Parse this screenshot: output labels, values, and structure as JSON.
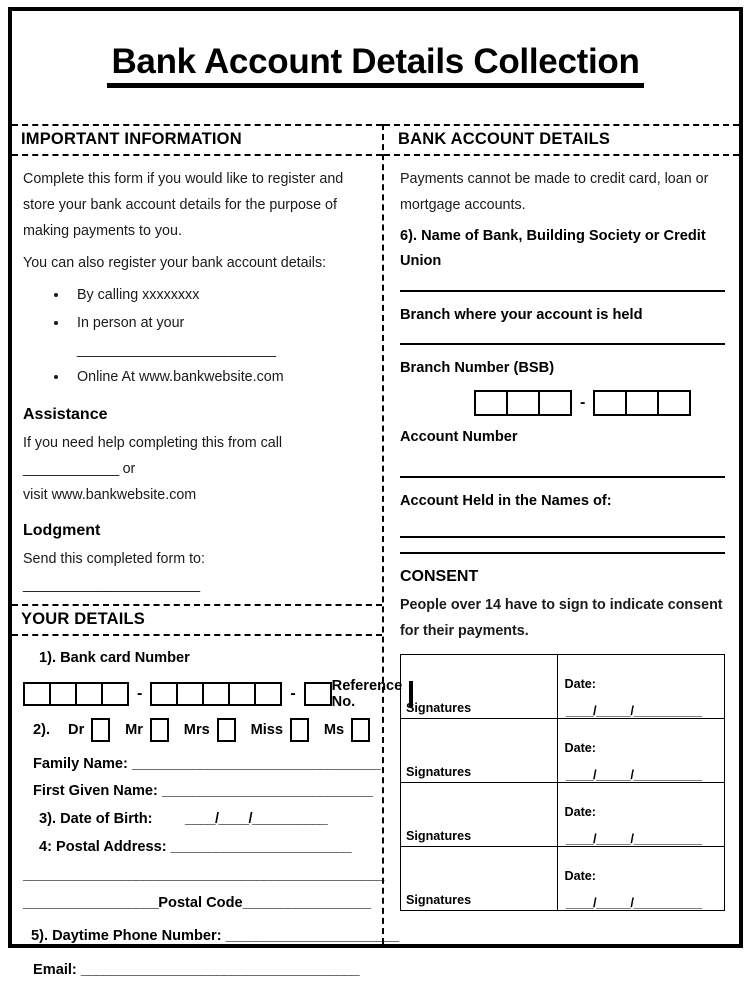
{
  "title": "Bank Account Details Collection",
  "left": {
    "important": {
      "header": "IMPORTANT INFORMATION",
      "intro": "Complete this form if you would like to register and store your bank account details for the purpose of making payments to you.",
      "register_lead": "You can also register your bank account details:",
      "bullets": [
        "By calling xxxxxxxx",
        "In person at your",
        "Online At www.bankwebsite.com"
      ],
      "in_person_blank": "___________________________",
      "assistance_header": "Assistance",
      "assistance_text_before": "If you need help completing this from call",
      "assistance_blank": "_____________",
      "assistance_text_after": "or",
      "assistance_line2": "visit www.bankwebsite.com",
      "lodgment_header": "Lodgment",
      "lodgment_text": "Send this completed form to:",
      "lodgment_blank": "________________________"
    },
    "your_details": {
      "header": "YOUR DETAILS",
      "card_label": "1). Bank card Number",
      "card_group1_boxes": 4,
      "card_group2_boxes": 5,
      "card_group3_boxes": 1,
      "separator": "-",
      "reference_label": "Reference No.",
      "title_row_num": "2).",
      "titles": [
        "Dr",
        "Mr",
        "Mrs",
        "Miss",
        "Ms"
      ],
      "family_name_label": "Family Name:",
      "family_name_blank": "_________________________________",
      "first_name_label": "First Given Name:",
      "first_name_blank": "____________________________",
      "dob_label": "3). Date of Birth:",
      "dob_blank": "____/____/__________",
      "postal_label": "4: Postal Address:",
      "postal_blank1": "________________________",
      "postal_blank2": "________________________________________________",
      "postal_code_pre": "__________________",
      "postal_code_label": "Postal Code",
      "postal_code_post": "_________________",
      "phone_label": "5). Daytime Phone Number:",
      "phone_blank": "_______________________",
      "email_label": "Email:",
      "email_blank": "_____________________________________"
    }
  },
  "right": {
    "bank_details": {
      "header": "BANK ACCOUNT DETAILS",
      "notice": "Payments cannot be made to credit card, loan or mortgage accounts.",
      "bank_name_label": "6). Name of Bank, Building Society or Credit Union",
      "branch_label": "Branch where your account is held",
      "bsb_label": "Branch Number (BSB)",
      "bsb_group1_boxes": 3,
      "bsb_group2_boxes": 3,
      "bsb_separator": "-",
      "account_number_label": "Account Number",
      "account_names_label": "Account Held in the Names of:"
    },
    "consent": {
      "header": "CONSENT",
      "text": "People over 14 have to sign to indicate consent for their payments.",
      "rows": [
        {
          "signature_label": "Signatures",
          "date_label": "Date:",
          "date_blank": "____/_____/__________"
        },
        {
          "signature_label": "Signatures",
          "date_label": "Date:",
          "date_blank": "____/_____/__________"
        },
        {
          "signature_label": "Signatures",
          "date_label": "Date:",
          "date_blank": "____/_____/__________"
        },
        {
          "signature_label": "Signatures",
          "date_label": "Date:",
          "date_blank": "____/_____/__________"
        }
      ]
    }
  }
}
